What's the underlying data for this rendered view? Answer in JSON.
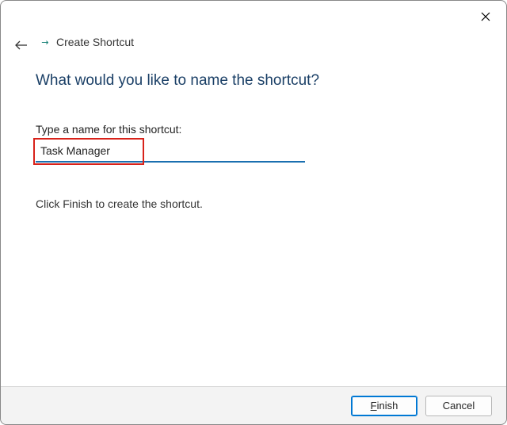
{
  "window": {
    "title": "Create Shortcut"
  },
  "main": {
    "heading": "What would you like to name the shortcut?",
    "input_label": "Type a name for this shortcut:",
    "input_value": "Task Manager",
    "instruction": "Click Finish to create the shortcut."
  },
  "footer": {
    "finish_prefix": "F",
    "finish_rest": "inish",
    "cancel_label": "Cancel"
  },
  "colors": {
    "accent": "#1a3f66",
    "input_underline": "#1a6fb0",
    "highlight": "#d8221a",
    "footer_bg": "#f3f3f3"
  }
}
